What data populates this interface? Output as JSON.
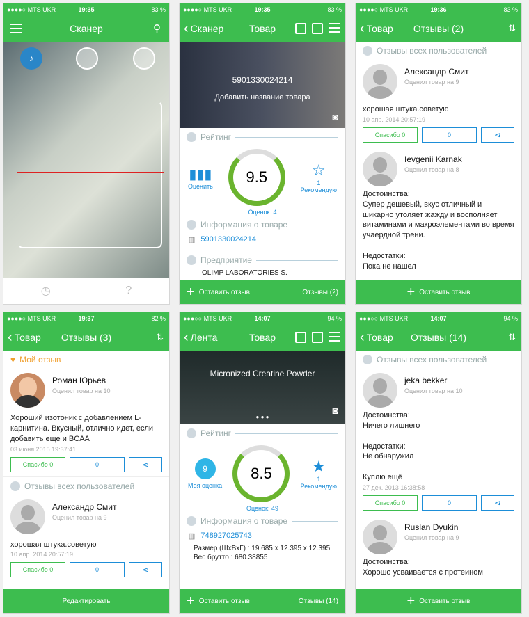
{
  "carrier": "●●●●○ MTS UKR",
  "carrier2": "●●●○○ MTS UKR",
  "s1": {
    "time": "19:35",
    "battery": "83 %",
    "title": "Сканер"
  },
  "s2": {
    "time": "19:35",
    "battery": "83 %",
    "back": "Сканер",
    "title": "Товар",
    "barcode": "5901330024214",
    "add_name": "Добавить название товара",
    "rating_label": "Рейтинг",
    "rate_label": "Оценить",
    "score": "9.5",
    "votes": "Оценок: 4",
    "rec_count": "1",
    "rec_label": "Рекомендую",
    "info_label": "Информация о товаре",
    "info_barcode": "5901330024214",
    "company_label": "Предприятие",
    "company_value": "OLIMP LABORATORIES S.",
    "footer_left": "Оставить отзыв",
    "footer_right": "Отзывы (2)"
  },
  "s3": {
    "time": "19:36",
    "battery": "83 %",
    "back": "Товар",
    "title": "Отзывы (2)",
    "section": "Отзывы всех пользователей",
    "reviews": [
      {
        "name": "Александр Смит",
        "sub": "Оценил товар на 9",
        "text": "хорошая штука.советую",
        "date": "10 апр. 2014 20:57:19"
      },
      {
        "name": "Ievgenii Karnak",
        "sub": "Оценил товар на 8",
        "text": "Достоинства:\nСупер дешевый, вкус отличный и шикарно утоляет жажду и восполняет витаминами и макроэлементами во время учаердной трени.\n\nНедостатки:\nПока не нашел"
      }
    ],
    "thanks": "Спасибо 0",
    "comments": "0",
    "footer": "Оставить отзыв"
  },
  "s4": {
    "time": "19:37",
    "battery": "82 %",
    "back": "Товар",
    "title": "Отзывы (3)",
    "my_section": "Мой отзыв",
    "all_section": "Отзывы всех пользователей",
    "my": {
      "name": "Роман Юрьев",
      "sub": "Оценил товар на 10",
      "text": "Хороший изотоник с добавлением L-карнитина. Вкусный, отлично идет, если добавить еще и BCAA",
      "date": "03 июня 2015 19:37:41"
    },
    "other": {
      "name": "Александр Смит",
      "sub": "Оценил товар на 9",
      "text": "хорошая штука.советую",
      "date": "10 апр. 2014 20:57:19"
    },
    "thanks": "Спасибо 0",
    "comments": "0",
    "footer": "Редактировать"
  },
  "s5": {
    "time": "14:07",
    "battery": "94 %",
    "back": "Лента",
    "title": "Товар",
    "product": "Micronized Creatine Powder",
    "rating_label": "Рейтинг",
    "my_score": "9",
    "my_label": "Моя оценка",
    "score": "8.5",
    "votes": "Оценок: 49",
    "rec_count": "1",
    "rec_label": "Рекомендую",
    "info_label": "Информация о товаре",
    "barcode": "748927025743",
    "size": "Размер (ШхВхГ) : 19.685 x 12.395 x 12.395",
    "weight": "Вес брутто : 680.38855",
    "footer_left": "Оставить отзыв",
    "footer_right": "Отзывы (14)"
  },
  "s6": {
    "time": "14:07",
    "battery": "94 %",
    "back": "Товар",
    "title": "Отзывы (14)",
    "section": "Отзывы всех пользователей",
    "reviews": [
      {
        "name": "jeka bekker",
        "sub": "Оценил товар на 10",
        "text": "Достоинства:\nНичего лишнего\n\nНедостатки:\nНе обнаружил\n\nКуплю ещё",
        "date": "27 дек. 2013 16:38:58"
      },
      {
        "name": "Ruslan Dyukin",
        "sub": "Оценил товар на 9",
        "text": "Достоинства:\nХорошо усваивается с протеином"
      }
    ],
    "thanks": "Спасибо 0",
    "comments": "0",
    "footer": "Оставить отзыв"
  },
  "colors": {
    "accent": "#3dbd4f",
    "blue": "#1d8ed8",
    "orange": "#f0a030"
  }
}
